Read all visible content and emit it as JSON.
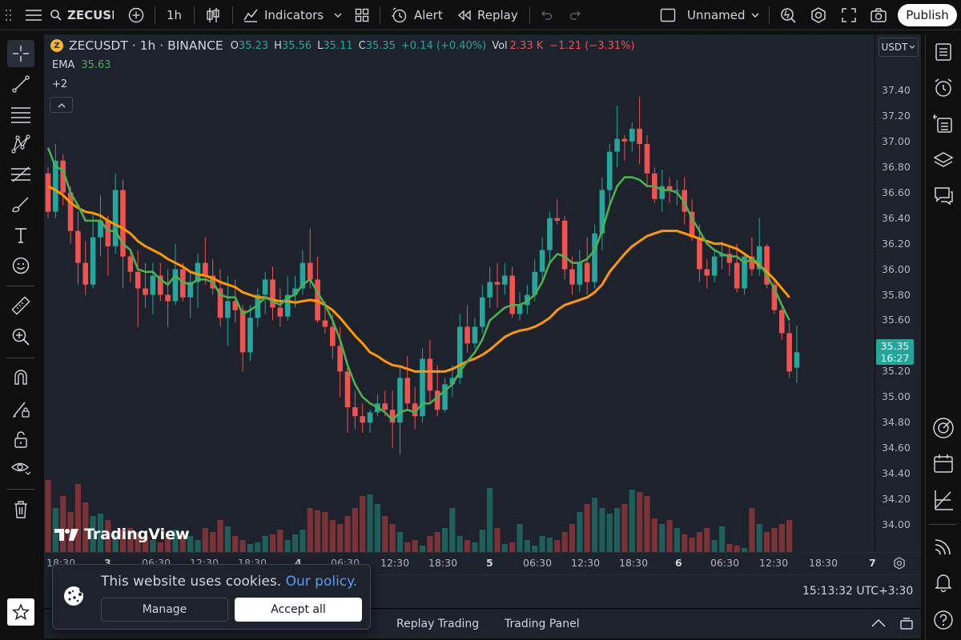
{
  "topbar": {
    "symbol": "ZECUSD",
    "interval": "1h",
    "indicators_label": "Indicators",
    "alert_label": "Alert",
    "replay_label": "Replay",
    "layout_name": "Unnamed",
    "publish_label": "Publish"
  },
  "legend": {
    "symbol_title": "ZECUSDT · 1h · BINANCE",
    "open_label": "O",
    "open_value": "35.23",
    "high_label": "H",
    "high_value": "35.56",
    "low_label": "L",
    "low_value": "35.11",
    "close_label": "C",
    "close_value": "35.35",
    "change": "+0.14 (+0.40%)",
    "vol_label": "Vol",
    "vol_value": "2.33 K",
    "vol_change": "−1.21 (−3.31%)",
    "ema_label": "EMA",
    "ema_value": "35.63",
    "more_indicators": "+2"
  },
  "price_axis": {
    "currency": "USDT",
    "current_price": "35.35",
    "countdown": "16:27"
  },
  "status": {
    "clock": "15:13:32 UTC+3:30"
  },
  "bottom": {
    "tab1": "Replay Trading",
    "tab2": "Trading Panel"
  },
  "cookie": {
    "message": "This website uses cookies.",
    "policy_link": "Our policy.",
    "manage_label": "Manage",
    "accept_label": "Accept all"
  },
  "watermark": "TradingView",
  "colors": {
    "up": "#26a69a",
    "down": "#ef5350",
    "ema_fast": "#4caf50",
    "ema_slow": "#ff9800",
    "price_tag": "#26a69a",
    "link": "#5b9cf6"
  },
  "chart_data": {
    "type": "candlestick",
    "symbol": "ZECUSDT",
    "interval": "1h",
    "price_ticks": [
      "37.40",
      "37.20",
      "37.00",
      "36.80",
      "36.60",
      "36.40",
      "36.20",
      "36.00",
      "35.80",
      "35.60",
      "35.40",
      "35.20",
      "35.00",
      "34.80",
      "34.60",
      "34.40",
      "34.20",
      "34.00"
    ],
    "time_ticks": [
      "18:30",
      "3",
      "06:30",
      "12:30",
      "18:30",
      "4",
      "06:30",
      "12:30",
      "18:30",
      "5",
      "06:30",
      "12:30",
      "18:30",
      "6",
      "06:30",
      "12:30",
      "18:30",
      "7"
    ],
    "ylim": [
      33.9,
      37.55
    ],
    "candles": [
      [
        36.75,
        36.8,
        36.4,
        36.45
      ],
      [
        36.45,
        36.98,
        36.4,
        36.85
      ],
      [
        36.85,
        36.9,
        36.5,
        36.6
      ],
      [
        36.6,
        36.65,
        36.2,
        36.3
      ],
      [
        36.3,
        36.45,
        35.88,
        36.05
      ],
      [
        36.05,
        36.22,
        35.8,
        35.88
      ],
      [
        35.88,
        36.45,
        35.85,
        36.25
      ],
      [
        36.25,
        36.58,
        36.1,
        36.38
      ],
      [
        36.38,
        36.42,
        35.95,
        36.18
      ],
      [
        36.18,
        36.75,
        36.12,
        36.62
      ],
      [
        36.62,
        36.7,
        35.85,
        36.1
      ],
      [
        36.1,
        36.16,
        35.9,
        35.98
      ],
      [
        35.98,
        36.15,
        35.55,
        35.85
      ],
      [
        35.85,
        36.05,
        35.7,
        35.8
      ],
      [
        35.8,
        36.05,
        35.65,
        35.95
      ],
      [
        35.95,
        36.05,
        35.75,
        35.8
      ],
      [
        35.8,
        36.0,
        35.55,
        35.75
      ],
      [
        35.75,
        36.2,
        35.72,
        36.0
      ],
      [
        36.0,
        36.05,
        35.75,
        35.78
      ],
      [
        35.78,
        35.98,
        35.62,
        35.9
      ],
      [
        35.9,
        36.12,
        35.7,
        36.05
      ],
      [
        36.05,
        36.25,
        35.88,
        35.95
      ],
      [
        35.95,
        36.08,
        35.8,
        35.85
      ],
      [
        35.85,
        36.0,
        35.55,
        35.62
      ],
      [
        35.62,
        35.95,
        35.4,
        35.75
      ],
      [
        35.75,
        35.92,
        35.58,
        35.68
      ],
      [
        35.68,
        35.72,
        35.2,
        35.35
      ],
      [
        35.35,
        35.72,
        35.28,
        35.62
      ],
      [
        35.62,
        35.85,
        35.55,
        35.8
      ],
      [
        35.8,
        35.98,
        35.65,
        35.92
      ],
      [
        35.92,
        36.02,
        35.6,
        35.7
      ],
      [
        35.7,
        35.85,
        35.55,
        35.63
      ],
      [
        35.63,
        35.95,
        35.6,
        35.8
      ],
      [
        35.8,
        35.95,
        35.7,
        35.85
      ],
      [
        35.85,
        36.15,
        35.8,
        36.05
      ],
      [
        36.05,
        36.32,
        35.85,
        35.92
      ],
      [
        35.92,
        36.1,
        35.58,
        35.6
      ],
      [
        35.6,
        35.75,
        35.5,
        35.55
      ],
      [
        35.55,
        35.65,
        35.3,
        35.4
      ],
      [
        35.4,
        35.55,
        35.0,
        35.2
      ],
      [
        35.2,
        35.25,
        34.72,
        34.92
      ],
      [
        34.92,
        35.05,
        34.75,
        34.85
      ],
      [
        34.85,
        34.95,
        34.72,
        34.8
      ],
      [
        34.8,
        34.9,
        34.72,
        34.88
      ],
      [
        34.88,
        35.02,
        34.85,
        34.95
      ],
      [
        34.95,
        35.05,
        34.85,
        34.9
      ],
      [
        34.9,
        35.05,
        34.6,
        34.8
      ],
      [
        34.8,
        35.25,
        34.55,
        35.15
      ],
      [
        35.15,
        35.32,
        34.9,
        34.95
      ],
      [
        34.95,
        35.08,
        34.75,
        34.85
      ],
      [
        34.85,
        35.38,
        34.8,
        35.3
      ],
      [
        35.3,
        35.45,
        34.95,
        35.05
      ],
      [
        35.05,
        35.25,
        34.85,
        34.9
      ],
      [
        34.9,
        35.15,
        34.88,
        35.1
      ],
      [
        35.1,
        35.25,
        35.0,
        35.15
      ],
      [
        35.15,
        35.65,
        35.1,
        35.55
      ],
      [
        35.55,
        35.72,
        35.35,
        35.42
      ],
      [
        35.42,
        35.62,
        35.38,
        35.55
      ],
      [
        35.55,
        35.88,
        35.5,
        35.78
      ],
      [
        35.78,
        36.02,
        35.7,
        35.9
      ],
      [
        35.9,
        36.05,
        35.7,
        35.88
      ],
      [
        35.88,
        36.05,
        35.8,
        35.95
      ],
      [
        35.95,
        36.02,
        35.62,
        35.65
      ],
      [
        35.65,
        35.82,
        35.6,
        35.72
      ],
      [
        35.72,
        35.88,
        35.65,
        35.8
      ],
      [
        35.8,
        36.08,
        35.75,
        35.98
      ],
      [
        35.98,
        36.25,
        35.9,
        36.15
      ],
      [
        36.15,
        36.45,
        36.05,
        36.4
      ],
      [
        36.4,
        36.55,
        36.35,
        36.38
      ],
      [
        36.38,
        36.42,
        35.92,
        36.0
      ],
      [
        36.0,
        36.1,
        35.8,
        35.88
      ],
      [
        35.88,
        36.15,
        35.82,
        36.05
      ],
      [
        36.05,
        36.25,
        35.8,
        35.9
      ],
      [
        35.9,
        36.35,
        35.85,
        36.28
      ],
      [
        36.28,
        36.72,
        36.15,
        36.62
      ],
      [
        36.62,
        36.98,
        36.5,
        36.92
      ],
      [
        36.92,
        37.28,
        36.8,
        37.02
      ],
      [
        37.02,
        37.05,
        36.85,
        37.0
      ],
      [
        37.0,
        37.15,
        36.92,
        37.1
      ],
      [
        37.1,
        37.35,
        36.82,
        36.98
      ],
      [
        36.98,
        37.05,
        36.65,
        36.75
      ],
      [
        36.75,
        36.8,
        36.52,
        36.55
      ],
      [
        36.55,
        36.78,
        36.45,
        36.65
      ],
      [
        36.65,
        36.72,
        36.52,
        36.62
      ],
      [
        36.62,
        36.7,
        36.5,
        36.62
      ],
      [
        36.62,
        36.72,
        36.35,
        36.45
      ],
      [
        36.45,
        36.55,
        36.22,
        36.25
      ],
      [
        36.25,
        36.35,
        35.9,
        36.0
      ],
      [
        36.0,
        36.08,
        35.85,
        35.95
      ],
      [
        35.95,
        36.15,
        35.9,
        36.1
      ],
      [
        36.1,
        36.22,
        36.0,
        36.12
      ],
      [
        36.12,
        36.18,
        35.95,
        36.05
      ],
      [
        36.05,
        36.2,
        35.82,
        35.85
      ],
      [
        35.85,
        36.12,
        35.8,
        36.1
      ],
      [
        36.1,
        36.25,
        35.95,
        36.0
      ],
      [
        36.0,
        36.4,
        35.95,
        36.18
      ],
      [
        36.18,
        36.2,
        35.85,
        35.88
      ],
      [
        35.88,
        35.92,
        35.65,
        35.68
      ],
      [
        35.68,
        35.7,
        35.45,
        35.5
      ],
      [
        35.5,
        35.58,
        35.15,
        35.2
      ],
      [
        35.23,
        35.56,
        35.11,
        35.35
      ]
    ],
    "ema_fast": [
      36.95,
      36.8,
      36.78,
      36.6,
      36.5,
      36.38,
      36.38,
      36.38,
      36.3,
      36.3,
      36.2,
      36.15,
      36.0,
      35.98,
      35.98,
      35.92,
      35.88,
      35.95,
      35.9,
      35.88,
      35.92,
      35.92,
      35.9,
      35.8,
      35.78,
      35.78,
      35.65,
      35.68,
      35.72,
      35.78,
      35.75,
      35.72,
      35.78,
      35.8,
      35.88,
      35.92,
      35.82,
      35.72,
      35.6,
      35.45,
      35.25,
      35.1,
      35.0,
      34.95,
      34.92,
      34.88,
      34.82,
      34.88,
      34.9,
      34.88,
      34.95,
      34.95,
      35.0,
      35.05,
      35.1,
      35.2,
      35.28,
      35.35,
      35.45,
      35.6,
      35.65,
      35.7,
      35.72,
      35.72,
      35.75,
      35.8,
      35.9,
      36.05,
      36.12,
      36.1,
      36.05,
      36.05,
      36.08,
      36.15,
      36.3,
      36.5,
      36.65,
      36.72,
      36.72,
      36.7,
      36.65,
      36.65,
      36.62,
      36.62,
      36.6,
      36.52,
      36.4,
      36.3,
      36.2,
      36.15,
      36.12,
      36.1,
      36.1,
      36.05,
      36.08,
      36.05,
      35.95,
      35.85,
      35.72,
      35.6
    ],
    "ema_slow": [
      36.65,
      36.62,
      36.58,
      36.52,
      36.48,
      36.45,
      36.44,
      36.42,
      36.38,
      36.35,
      36.32,
      36.28,
      36.22,
      36.18,
      36.15,
      36.12,
      36.08,
      36.05,
      36.02,
      35.98,
      35.96,
      35.95,
      35.93,
      35.9,
      35.88,
      35.86,
      35.82,
      35.8,
      35.78,
      35.78,
      35.76,
      35.75,
      35.75,
      35.74,
      35.75,
      35.76,
      35.75,
      35.72,
      35.68,
      35.62,
      35.55,
      35.48,
      35.42,
      35.35,
      35.32,
      35.28,
      35.25,
      35.24,
      35.22,
      35.2,
      35.2,
      35.2,
      35.2,
      35.2,
      35.22,
      35.25,
      35.28,
      35.3,
      35.33,
      35.37,
      35.42,
      35.47,
      35.5,
      35.52,
      35.53,
      35.55,
      35.58,
      35.62,
      35.68,
      35.72,
      35.74,
      35.76,
      35.78,
      35.82,
      35.88,
      35.98,
      36.05,
      36.12,
      36.18,
      36.22,
      36.26,
      36.28,
      36.3,
      36.3,
      36.3,
      36.28,
      36.26,
      36.24,
      36.22,
      36.2,
      36.2,
      36.18,
      36.16,
      36.12,
      36.08,
      36.03,
      35.98,
      35.92,
      35.85,
      35.78
    ],
    "volume": [
      90,
      55,
      70,
      50,
      85,
      62,
      45,
      48,
      40,
      22,
      28,
      30,
      25,
      20,
      15,
      12,
      18,
      28,
      22,
      20,
      15,
      30,
      25,
      40,
      32,
      20,
      15,
      10,
      12,
      20,
      22,
      28,
      15,
      22,
      28,
      55,
      52,
      50,
      40,
      35,
      45,
      55,
      70,
      72,
      60,
      45,
      35,
      25,
      12,
      15,
      8,
      20,
      25,
      30,
      55,
      20,
      15,
      12,
      28,
      80,
      30,
      10,
      12,
      35,
      15,
      8,
      20,
      18,
      15,
      25,
      35,
      50,
      60,
      68,
      55,
      48,
      55,
      60,
      78,
      75,
      70,
      42,
      35,
      40,
      30,
      22,
      18,
      25,
      30,
      15,
      32,
      10,
      8,
      5,
      55,
      35,
      25,
      30,
      35,
      40
    ],
    "last_price": 35.35
  }
}
